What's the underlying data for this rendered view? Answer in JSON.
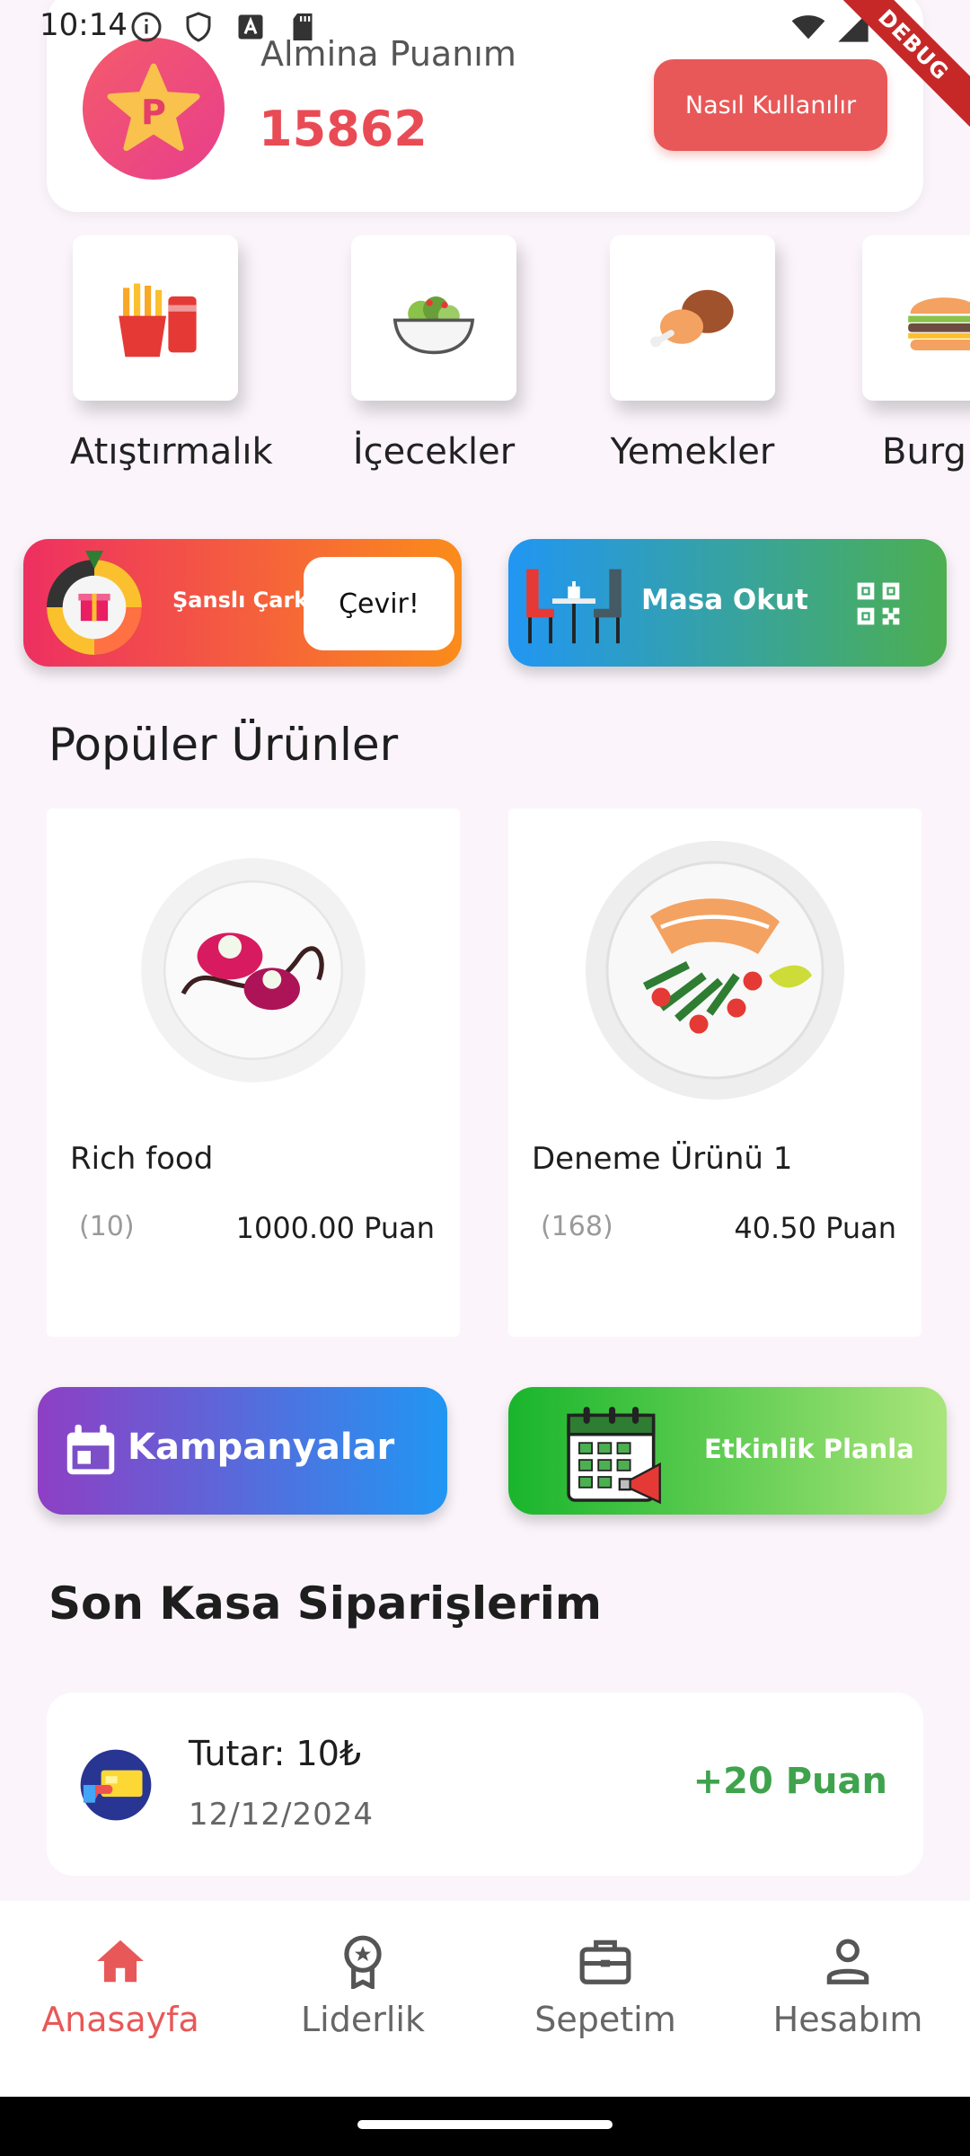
{
  "status_bar": {
    "time": "10:14",
    "debug_label": "DEBUG"
  },
  "points_card": {
    "title": "Almina Puanım",
    "value": "15862",
    "logo_letter": "P",
    "howto_label": "Nasıl Kullanılır"
  },
  "categories": [
    {
      "label": "Atıştırmalık",
      "icon": "fries-soda-icon"
    },
    {
      "label": "İçecekler",
      "icon": "salad-bowl-icon"
    },
    {
      "label": "Yemekler",
      "icon": "chicken-leg-icon"
    },
    {
      "label": "Burg",
      "icon": "burger-icon"
    }
  ],
  "lucky_wheel": {
    "label": "Şanslı Çark",
    "button_label": "Çevir!"
  },
  "table_scan": {
    "label": "Masa Okut"
  },
  "popular": {
    "title": "Popüler Ürünler",
    "products": [
      {
        "name": "Rich food",
        "count": "(10)",
        "price": "1000.00 Puan"
      },
      {
        "name": "Deneme Ürünü 1",
        "count": "(168)",
        "price": "40.50 Puan"
      }
    ]
  },
  "campaigns": {
    "label": "Kampanyalar"
  },
  "event_plan": {
    "label": "Etkinlik Planla"
  },
  "orders": {
    "title": "Son Kasa Siparişlerim",
    "items": [
      {
        "amount": "Tutar: 10₺",
        "date": "12/12/2024",
        "points": "+20 Puan"
      }
    ]
  },
  "bottom_nav": [
    {
      "label": "Anasayfa",
      "icon": "home-icon",
      "active": true
    },
    {
      "label": "Liderlik",
      "icon": "award-icon",
      "active": false
    },
    {
      "label": "Sepetim",
      "icon": "briefcase-icon",
      "active": false
    },
    {
      "label": "Hesabım",
      "icon": "person-icon",
      "active": false
    }
  ],
  "colors": {
    "accent": "#e85858",
    "points_value": "#e94b55",
    "success": "#3fa34d",
    "background": "#fbf5fb"
  }
}
